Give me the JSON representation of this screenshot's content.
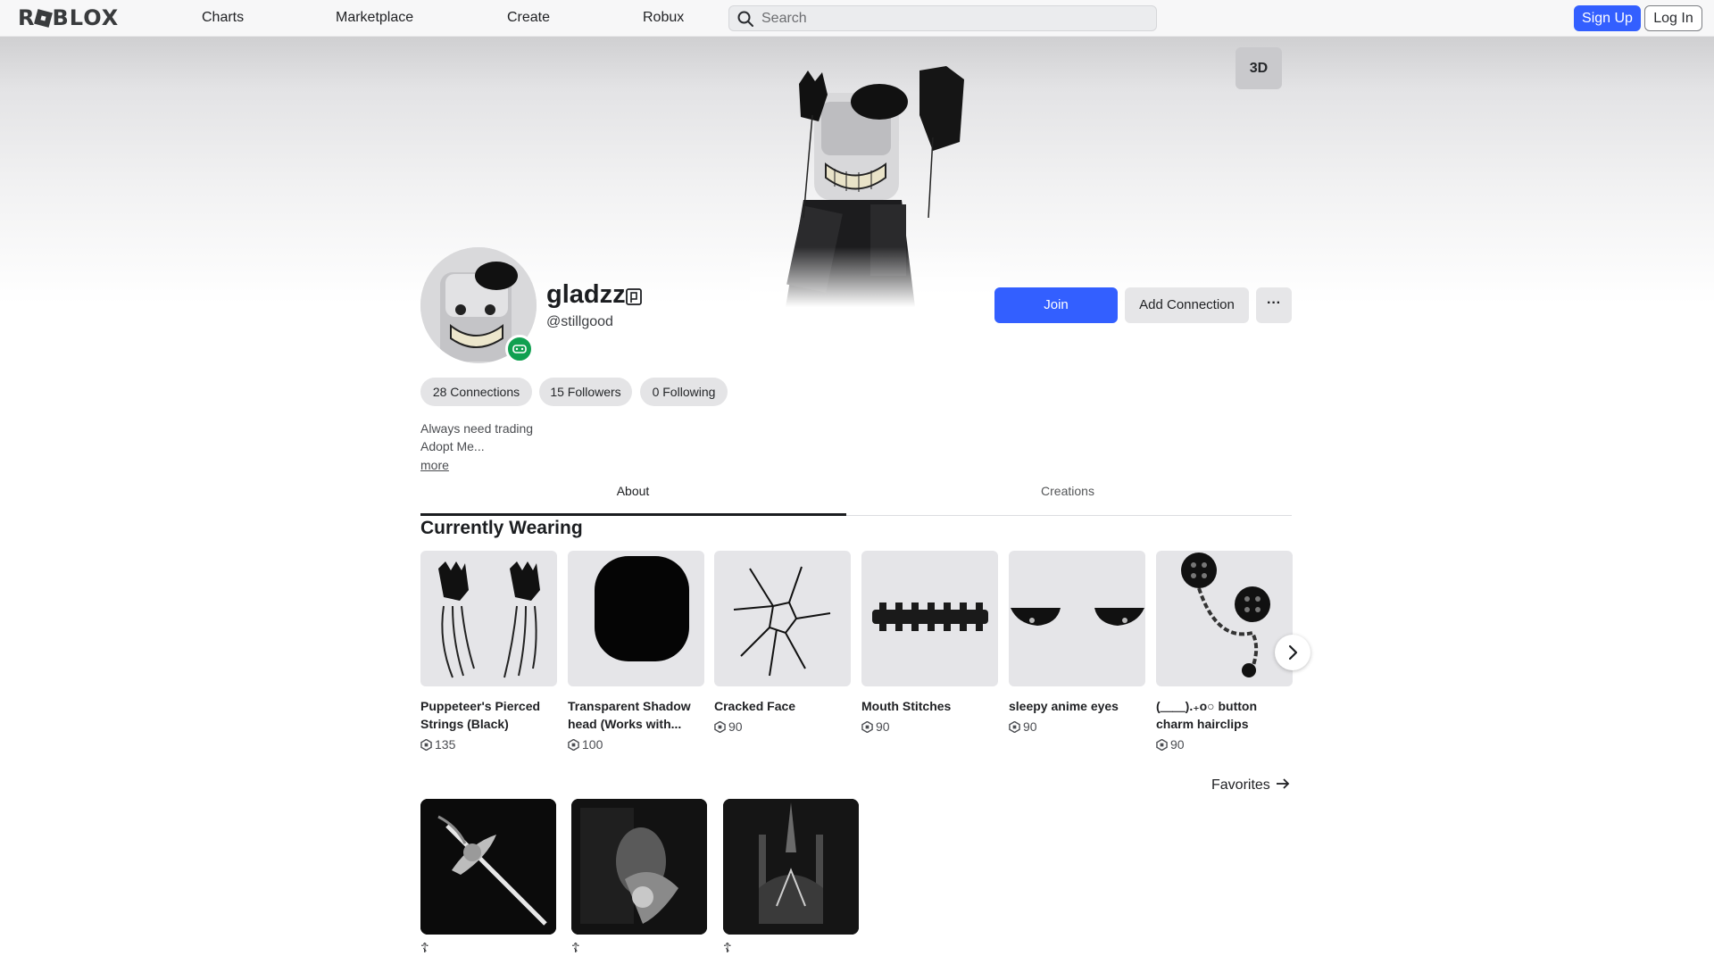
{
  "nav": {
    "logo": "ROBLOX",
    "links": [
      "Charts",
      "Marketplace",
      "Create",
      "Robux"
    ],
    "search_placeholder": "Search",
    "signup_label": "Sign Up",
    "login_label": "Log In"
  },
  "hero": {
    "view_toggle_label": "3D"
  },
  "profile": {
    "display_name": "gladzz",
    "username": "@stillgood",
    "join_label": "Join",
    "add_connection_label": "Add Connection",
    "more_label": "···",
    "stats": [
      "28 Connections",
      "15 Followers",
      "0 Following"
    ],
    "bio_lines": [
      "Always need trading",
      "Adopt Me..."
    ],
    "more_link": "more"
  },
  "tabs": {
    "about": "About",
    "creations": "Creations",
    "active": "About"
  },
  "wearing": {
    "title": "Currently Wearing",
    "items": [
      {
        "name": "Puppeteer's Pierced Strings (Black)",
        "price": "135"
      },
      {
        "name": "Transparent Shadow head (Works with...",
        "price": "100"
      },
      {
        "name": "Cracked Face",
        "price": "90"
      },
      {
        "name": "Mouth Stitches",
        "price": "90"
      },
      {
        "name": "sleepy anime eyes",
        "price": "90"
      },
      {
        "name": "(＿＿).₊o○ button charm hairclips",
        "price": "90"
      }
    ]
  },
  "favorites": {
    "link_label": "Favorites",
    "items": [
      {
        "name": "☦"
      },
      {
        "name": "☦"
      },
      {
        "name": "☦"
      }
    ]
  },
  "colors": {
    "accent_blue": "#335fff",
    "online_green": "#10a050",
    "pill_bg": "#e4e4e6",
    "item_bg": "#e5e5e8"
  }
}
